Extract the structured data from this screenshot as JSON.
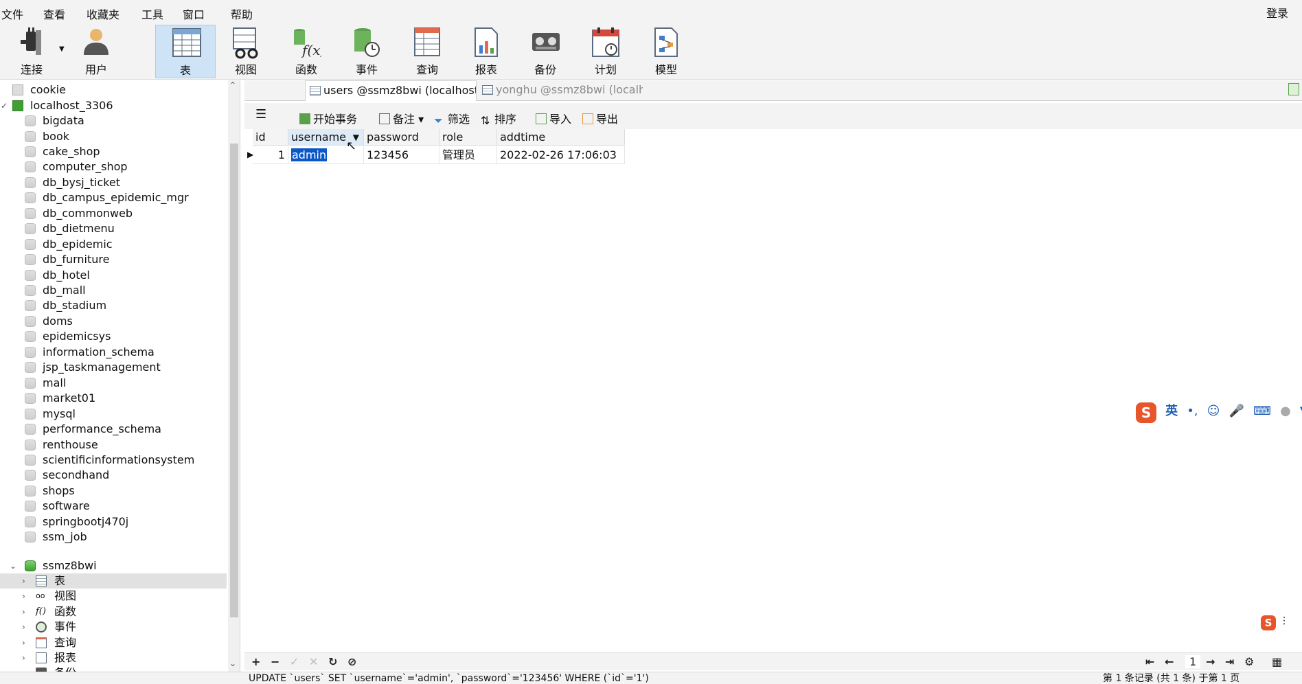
{
  "menu": [
    "文件",
    "查看",
    "收藏夹",
    "工具",
    "窗口",
    "帮助"
  ],
  "login_label": "登录",
  "toolbar": {
    "connect": "连接",
    "user": "用户",
    "table": "表",
    "view": "视图",
    "function": "函数",
    "event": "事件",
    "query": "查询",
    "report": "报表",
    "backup": "备份",
    "schedule": "计划",
    "model": "模型"
  },
  "tree": {
    "connections": [
      "cookie",
      "localhost_3306"
    ],
    "databases": [
      "bigdata",
      "book",
      "cake_shop",
      "computer_shop",
      "db_bysj_ticket",
      "db_campus_epidemic_mgr",
      "db_commonweb",
      "db_dietmenu",
      "db_epidemic",
      "db_furniture",
      "db_hotel",
      "db_mall",
      "db_stadium",
      "doms",
      "epidemicsys",
      "information_schema",
      "jsp_taskmanagement",
      "mall",
      "market01",
      "mysql",
      "performance_schema",
      "renthouse",
      "scientificinformationsystem",
      "secondhand",
      "shops",
      "software",
      "springbootj470j",
      "ssm_job"
    ],
    "open_db": "ssmz8bwi",
    "children": [
      "表",
      "视图",
      "函数",
      "事件",
      "查询",
      "报表",
      "备份"
    ]
  },
  "tabs": [
    "users @ssmz8bwi (localhost...",
    "yonghu @ssmz8bwi (localh..."
  ],
  "objbar": {
    "begin_txn": "开始事务",
    "note": "备注",
    "filter": "筛选",
    "sort": "排序",
    "import": "导入",
    "export": "导出"
  },
  "grid": {
    "columns": [
      "id",
      "username",
      "password",
      "role",
      "addtime"
    ],
    "rows": [
      {
        "id": "1",
        "username": "admin",
        "password": "123456",
        "role": "管理员",
        "addtime": "2022-02-26 17:06:03"
      }
    ]
  },
  "pager": {
    "page": "1"
  },
  "status": {
    "sql": "UPDATE `users` SET `username`='admin', `password`='123456' WHERE (`id`='1')",
    "page_info": "第 1 条记录 (共 1 条) 于第 1 页"
  },
  "ime": {
    "lang": "英"
  },
  "colors": {
    "accent": "#0a58c8",
    "active_tool": "#cfe3f6",
    "green_db": "#3f9f35"
  }
}
